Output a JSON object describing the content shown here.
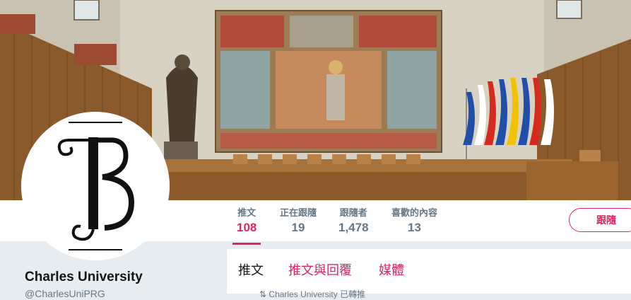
{
  "profile": {
    "name": "Charles University",
    "handle": "@CharlesUniPRG"
  },
  "stats": [
    {
      "label": "推文",
      "value": "108"
    },
    {
      "label": "正在跟隨",
      "value": "19"
    },
    {
      "label": "跟隨者",
      "value": "1,478"
    },
    {
      "label": "喜歡的內容",
      "value": "13"
    }
  ],
  "follow_button": "跟隨",
  "tabs": [
    "推文",
    "推文與回覆",
    "媒體"
  ],
  "timeline": {
    "retweet_text": "Charles University 已轉推",
    "retweet_icon": "retweet-icon"
  },
  "colors": {
    "accent": "#e0245e",
    "text_dark": "#14171a",
    "text_muted": "#657786",
    "background": "#e6ecf0"
  }
}
